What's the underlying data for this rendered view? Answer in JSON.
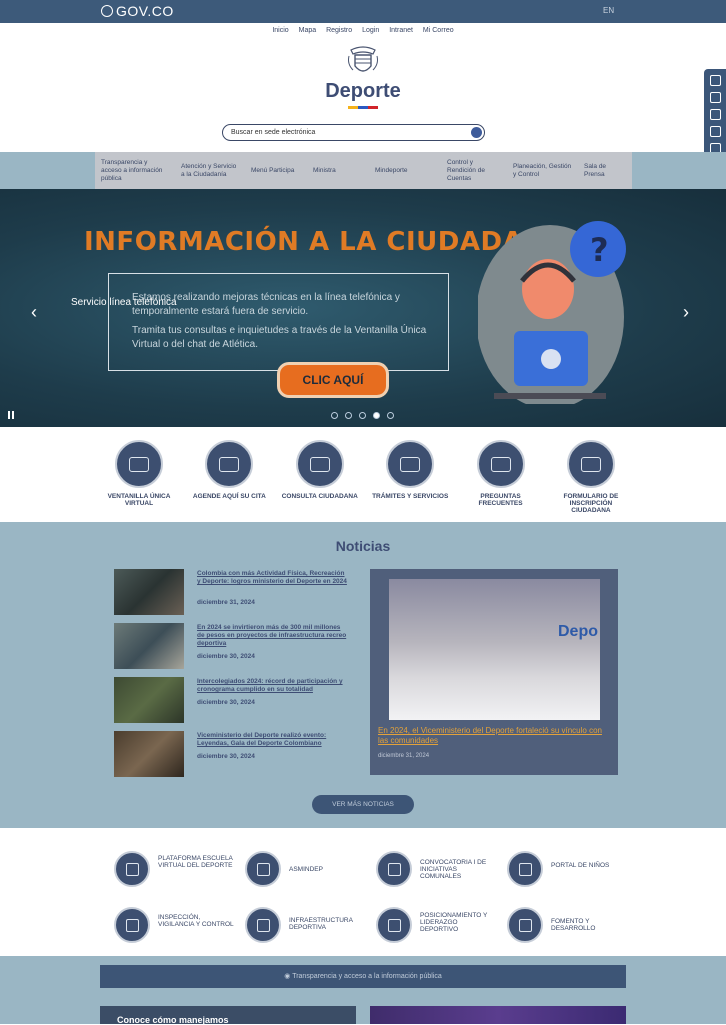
{
  "govbar": {
    "logo": "GOV.CO",
    "lang": "EN"
  },
  "toplinks": [
    "Inicio",
    "Mapa",
    "Registro",
    "Login",
    "Intranet",
    "Mi Correo"
  ],
  "brand": {
    "name": "Deporte"
  },
  "search": {
    "placeholder": "Buscar en sede electrónica"
  },
  "menu": [
    "Transparencia y acceso a información pública",
    "Atención y Servicio a la Ciudadanía",
    "Menú Participa",
    "Ministra",
    "Mindeporte",
    "Control y Rendición de Cuentas",
    "Planeación, Gestión y Control",
    "Sala de Prensa"
  ],
  "hero": {
    "title": "INFORMACIÓN A LA CIUDADANÍA",
    "caption": "Servicio línea telefónica",
    "p1": "Estamos realizando mejoras técnicas en la línea telefónica y temporalmente estará fuera de servicio.",
    "p2": "Tramita tus consultas e inquietudes a través de la Ventanilla Única Virtual o del chat de Atlética.",
    "cta": "CLIC AQUÍ",
    "prev": "‹",
    "next": "›"
  },
  "services": [
    "Ventanilla Única Virtual",
    "Agende aquí su cita",
    "Consulta ciudadana",
    "Trámites y servicios",
    "Preguntas frecuentes",
    "Formulario de inscripción ciudadana"
  ],
  "news": {
    "title": "Noticias",
    "items": [
      {
        "title": "Colombia con más Actividad Física, Recreación y Deporte: logros ministerio del Deporte en 2024",
        "date": "diciembre 31, 2024"
      },
      {
        "title": "En 2024 se invirtieron más de 300 mil millones de pesos en proyectos de infraestructura recreo deportiva",
        "date": "diciembre 30, 2024"
      },
      {
        "title": "Intercolegiados 2024: récord de participación y cronograma cumplido en su totalidad",
        "date": "diciembre 30, 2024"
      },
      {
        "title": "Viceministerio del Deporte realizó evento: Leyendas, Gala del Deporte Colombiano",
        "date": "diciembre 30, 2024"
      }
    ],
    "featured": {
      "title": "En 2024, el Viceministerio del Deporte fortaleció su vínculo con las comunidades",
      "date": "diciembre 31, 2024",
      "watermark": "Depo"
    },
    "more": "VER MÁS NOTICIAS"
  },
  "links": [
    "Plataforma Escuela Virtual del Deporte",
    "ASMINDEP",
    "Convocatoria i de iniciativas comunales",
    "Portal de niños",
    "Inspección, vigilancia y control",
    "Infraestructura deportiva",
    "Posicionamiento y liderazgo deportivo",
    "Fomento y desarrollo"
  ],
  "bottom": {
    "transparency": "Transparencia y acceso a la información pública",
    "card1": "Conoce cómo manejamos"
  },
  "colors": {
    "govbar": "#3d5a7a",
    "accent": "#e07b25",
    "navy": "#3d4f70",
    "band": "#9ab6c4"
  }
}
